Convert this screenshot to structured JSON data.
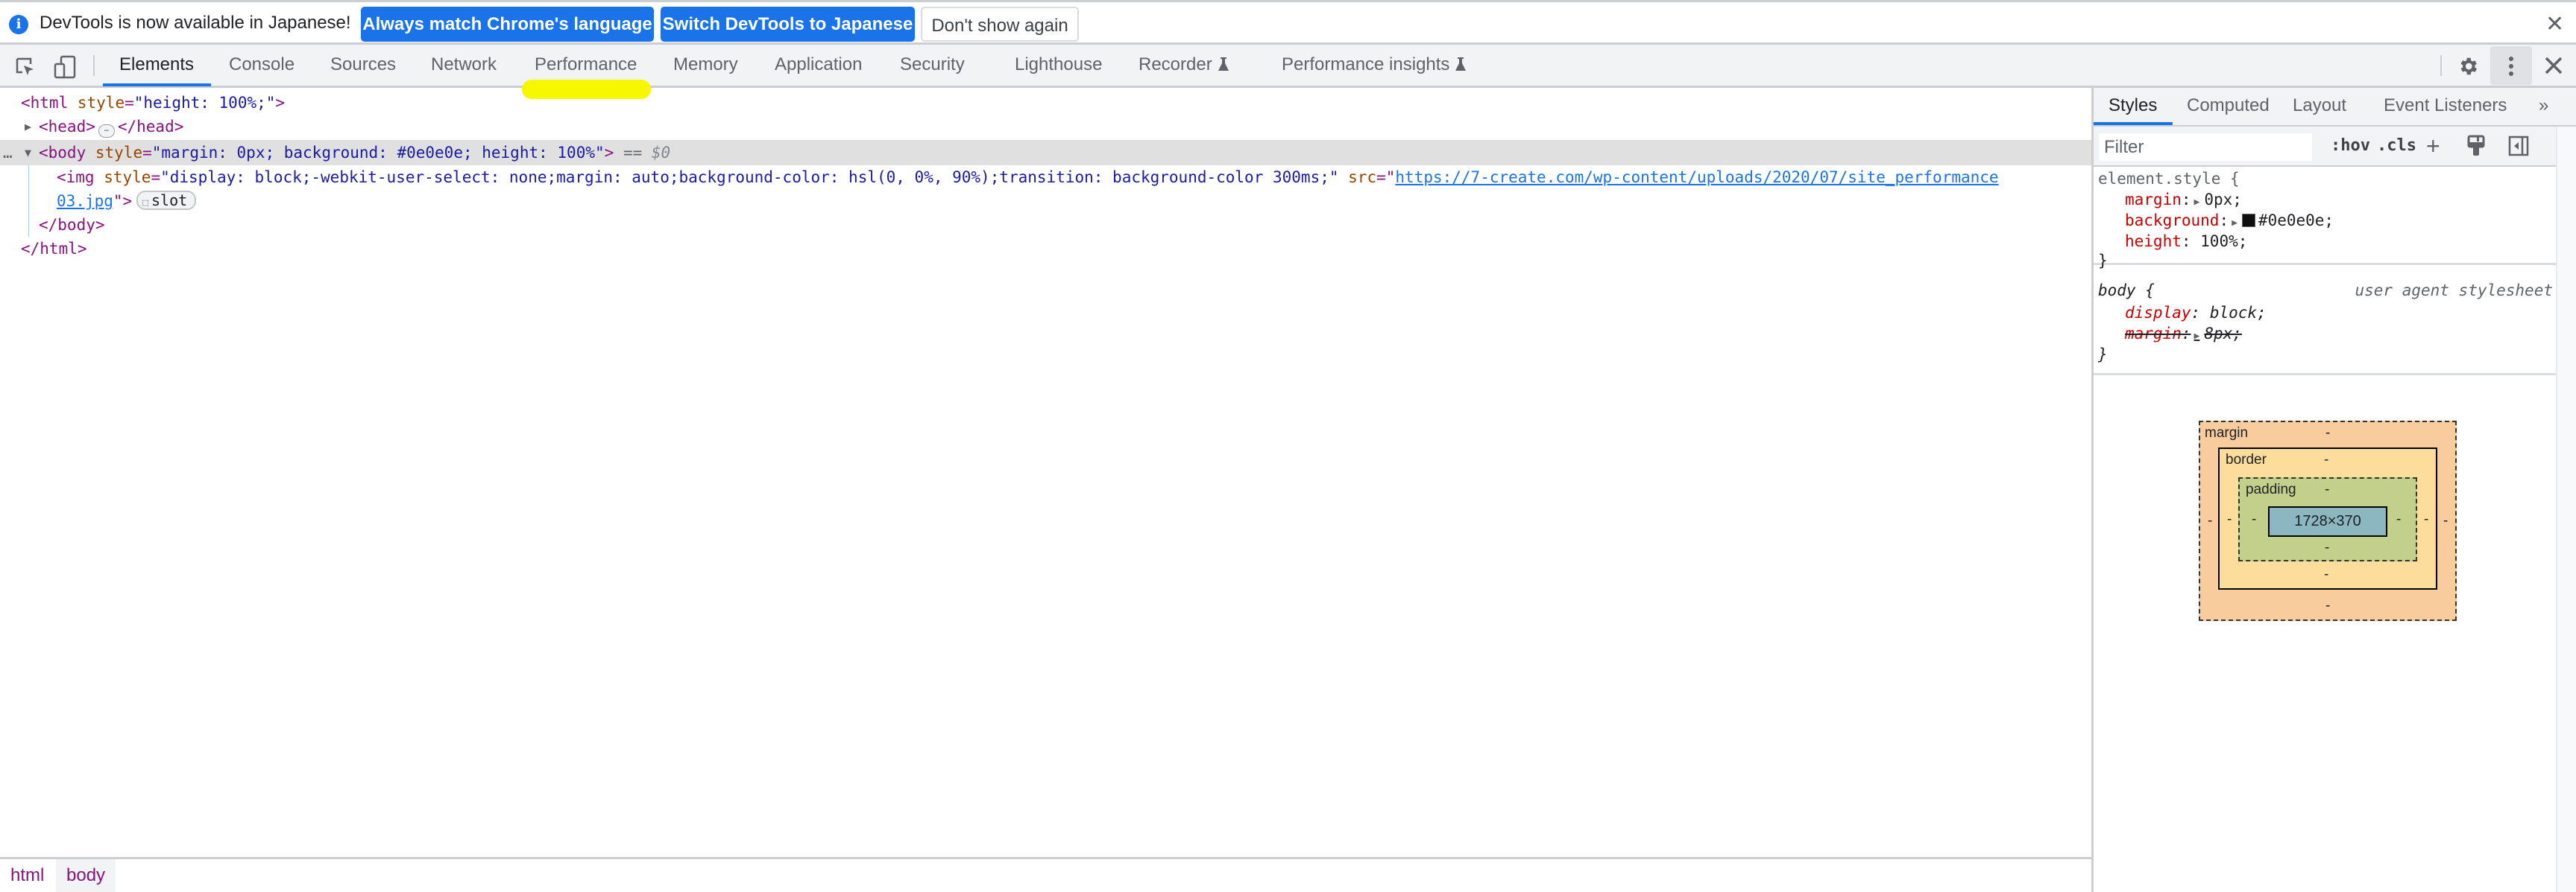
{
  "infobar": {
    "icon": "info-icon",
    "message": "DevTools is now available in Japanese!",
    "buttons": [
      {
        "label": "Always match Chrome's language",
        "style": "primary"
      },
      {
        "label": "Switch DevTools to Japanese",
        "style": "primary"
      },
      {
        "label": "Don't show again",
        "style": "secondary"
      }
    ],
    "close_icon": "close-icon"
  },
  "toolbar": {
    "left_icons": [
      "inspect-element-icon",
      "device-toolbar-icon"
    ],
    "tabs": [
      {
        "label": "Elements",
        "active": true
      },
      {
        "label": "Console"
      },
      {
        "label": "Sources"
      },
      {
        "label": "Network"
      },
      {
        "label": "Performance",
        "highlighted": true
      },
      {
        "label": "Memory"
      },
      {
        "label": "Application"
      },
      {
        "label": "Security"
      },
      {
        "label": "Lighthouse"
      },
      {
        "label": "Recorder",
        "experimental": true
      },
      {
        "label": "Performance insights",
        "experimental": true
      }
    ],
    "right_icons": [
      "gear-icon",
      "more-vertical-icon",
      "close-icon"
    ],
    "highlight_color": "#f7f700",
    "accent_color": "#1a73e8"
  },
  "dom": {
    "lines": {
      "html_open": {
        "tag": "<html",
        "attr": "style",
        "value": "\"height: 100%;\"",
        "close": ">"
      },
      "head": {
        "open": "<head>",
        "ellipsis": "…",
        "close": "</head>"
      },
      "body_open": {
        "dots": "…",
        "tag": "<body",
        "attr": "style",
        "value": "\"margin: 0px; background: #0e0e0e; height: 100%\"",
        "close": ">",
        "eq": "==",
        "ref": "$0"
      },
      "img": {
        "tag": "<img",
        "style_attr": "style",
        "style_value": "\"display: block;-webkit-user-select: none;margin: auto;background-color: hsl(0, 0%, 90%);transition: background-color 300ms;\"",
        "src_attr": "src",
        "src_quote": "\"",
        "src_url_line1": "https://7-create.com/wp-content/uploads/2020/07/site_performance",
        "src_url_line2": "03.jpg",
        "src_end": "\">",
        "slot_label": "slot"
      },
      "body_close": "</body>",
      "html_close": "</html>"
    }
  },
  "breadcrumbs": [
    {
      "label": "html"
    },
    {
      "label": "body",
      "active": true
    }
  ],
  "sidebar": {
    "tabs": [
      {
        "label": "Styles",
        "active": true
      },
      {
        "label": "Computed"
      },
      {
        "label": "Layout"
      },
      {
        "label": "Event Listeners"
      }
    ],
    "more_tabs_icon": "chevron-double-right-icon",
    "filter_placeholder": "Filter",
    "filter_value": "",
    "hov_label": ":hov",
    "cls_label": ".cls",
    "tool_icons": [
      "plus-icon",
      "paint-brush-icon",
      "toggle-sidebar-icon"
    ],
    "rules": {
      "element_style": {
        "selector": "element.style {",
        "props": [
          {
            "name": "margin",
            "value": "0px;",
            "expandable": true
          },
          {
            "name": "background",
            "value": "#0e0e0e;",
            "expandable": true,
            "swatch": "#0e0e0e"
          },
          {
            "name": "height",
            "value": "100%;"
          }
        ],
        "close": "}"
      },
      "body_ua": {
        "selector": "body {",
        "origin": "user agent stylesheet",
        "props": [
          {
            "name": "display",
            "value": "block;"
          },
          {
            "name": "margin",
            "value": "8px;",
            "overridden": true,
            "expandable": true
          }
        ],
        "close": "}"
      }
    },
    "box_model": {
      "margin_label": "margin",
      "border_label": "border",
      "padding_label": "padding",
      "content_size": "1728×370",
      "placeholder": "-",
      "colors": {
        "margin": "#f9cc9d",
        "border": "#fddd9b",
        "padding": "#c3d08b",
        "content": "#8cb6c0"
      }
    }
  }
}
